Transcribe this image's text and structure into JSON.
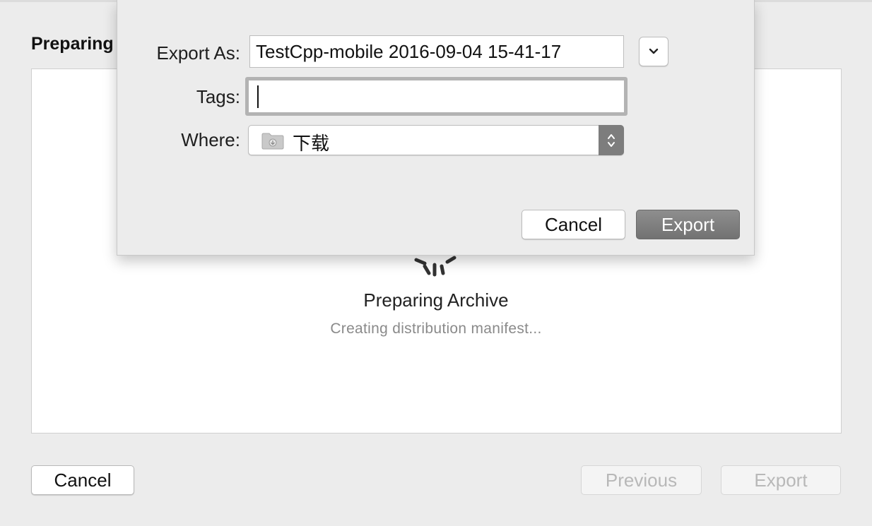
{
  "window": {
    "heading": "Preparing",
    "status_title": "Preparing Archive",
    "status_subtitle": "Creating distribution manifest...",
    "cancel_label": "Cancel",
    "previous_label": "Previous",
    "export_label": "Export"
  },
  "save_sheet": {
    "export_as_label": "Export As:",
    "export_as_value": "TestCpp-mobile 2016-09-04 15-41-17",
    "tags_label": "Tags:",
    "tags_value": "",
    "where_label": "Where:",
    "where_value": "下载",
    "cancel_label": "Cancel",
    "export_label": "Export"
  },
  "icons": {
    "expand": "chevron-down-icon",
    "folder": "folder-icon",
    "stepper": "up-down-stepper-icon",
    "spinner": "activity-spinner-icon"
  },
  "colors": {
    "background": "#ececec",
    "default_button": "#7d7d7d",
    "disabled_text": "#b8b8b8"
  }
}
